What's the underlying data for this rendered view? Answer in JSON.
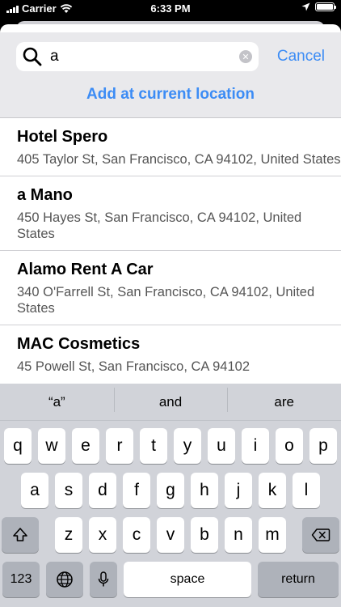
{
  "status_bar": {
    "carrier": "Carrier",
    "time": "6:33 PM",
    "battery_level": 1.0
  },
  "search": {
    "value": "a",
    "placeholder": "",
    "cancel_label": "Cancel",
    "add_current_label": "Add at current location"
  },
  "results": [
    {
      "name": "Hotel Spero",
      "address": "405 Taylor St, San Francisco, CA  94102, United States"
    },
    {
      "name": "a Mano",
      "address": "450 Hayes St, San Francisco, CA  94102, United States"
    },
    {
      "name": "Alamo Rent A Car",
      "address": "340 O'Farrell St, San Francisco, CA  94102, United States"
    },
    {
      "name": "MAC Cosmetics",
      "address": "45 Powell St, San Francisco, CA  94102"
    }
  ],
  "keyboard": {
    "suggestions": [
      "“a”",
      "and",
      "are"
    ],
    "row1": [
      "q",
      "w",
      "e",
      "r",
      "t",
      "y",
      "u",
      "i",
      "o",
      "p"
    ],
    "row2": [
      "a",
      "s",
      "d",
      "f",
      "g",
      "h",
      "j",
      "k",
      "l"
    ],
    "row3": [
      "z",
      "x",
      "c",
      "v",
      "b",
      "n",
      "m"
    ],
    "numbers_label": "123",
    "space_label": "space",
    "return_label": "return"
  },
  "colors": {
    "accent": "#3c8cf5",
    "keyboard_bg": "#d1d3d9",
    "search_bg": "#e9e9ec"
  }
}
